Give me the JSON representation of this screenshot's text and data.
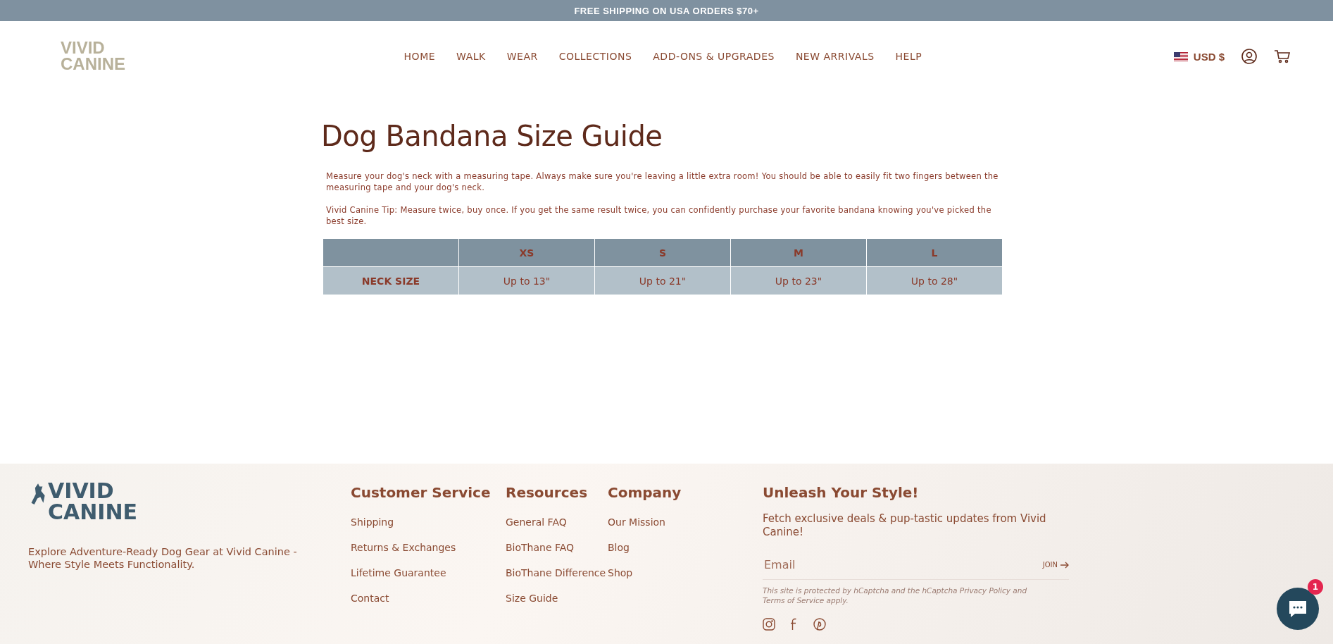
{
  "announcement": "FREE SHIPPING ON USA ORDERS $70+",
  "header": {
    "logo": [
      "VIVID",
      "CANINE"
    ],
    "nav": [
      {
        "label": "HOME"
      },
      {
        "label": "WALK"
      },
      {
        "label": "WEAR"
      },
      {
        "label": "COLLECTIONS"
      },
      {
        "label": "ADD-ONS & UPGRADES"
      },
      {
        "label": "NEW ARRIVALS"
      },
      {
        "label": "HELP"
      }
    ],
    "currency": "USD $"
  },
  "page": {
    "title": "Dog Bandana Size Guide",
    "paragraphs": [
      "Measure your dog's neck with a measuring tape. Always make sure you're leaving a little extra room! You should be able to easily fit two fingers between the measuring tape and your dog's neck.",
      "Vivid Canine Tip: Measure twice, buy once. If you get the same result twice, you can confidently purchase your favorite bandana knowing you've picked the best size."
    ],
    "table": {
      "columns": [
        "XS",
        "S",
        "M",
        "L"
      ],
      "rows": [
        {
          "label": "NECK SIZE",
          "cells": [
            "Up to 13\"",
            "Up to 21\"",
            "Up to 23\"",
            "Up to 28\""
          ]
        }
      ]
    }
  },
  "footer": {
    "logo": [
      "VIVID",
      "CANINE"
    ],
    "tagline": "Explore Adventure-Ready Dog Gear at Vivid Canine - Where Style Meets Functionality.",
    "columns": [
      {
        "heading": "Customer Service",
        "links": [
          "Shipping",
          "Returns & Exchanges",
          "Lifetime Guarantee",
          "Contact"
        ]
      },
      {
        "heading": "Resources",
        "links": [
          "General FAQ",
          "BioThane FAQ",
          "BioThane Difference",
          "Size Guide"
        ]
      },
      {
        "heading": "Company",
        "links": [
          "Our Mission",
          "Blog",
          "Shop"
        ]
      }
    ],
    "newsletter": {
      "heading": "Unleash Your Style!",
      "text": "Fetch exclusive deals & pup-tastic updates from Vivid Canine!",
      "placeholder": "Email",
      "button": "JOIN",
      "notice_before": "This site is protected by hCaptcha and the hCaptcha ",
      "privacy": "Privacy Policy",
      "notice_mid": " and ",
      "terms": "Terms of Service",
      "notice_after": " apply."
    }
  },
  "chat": {
    "badge": "1"
  }
}
